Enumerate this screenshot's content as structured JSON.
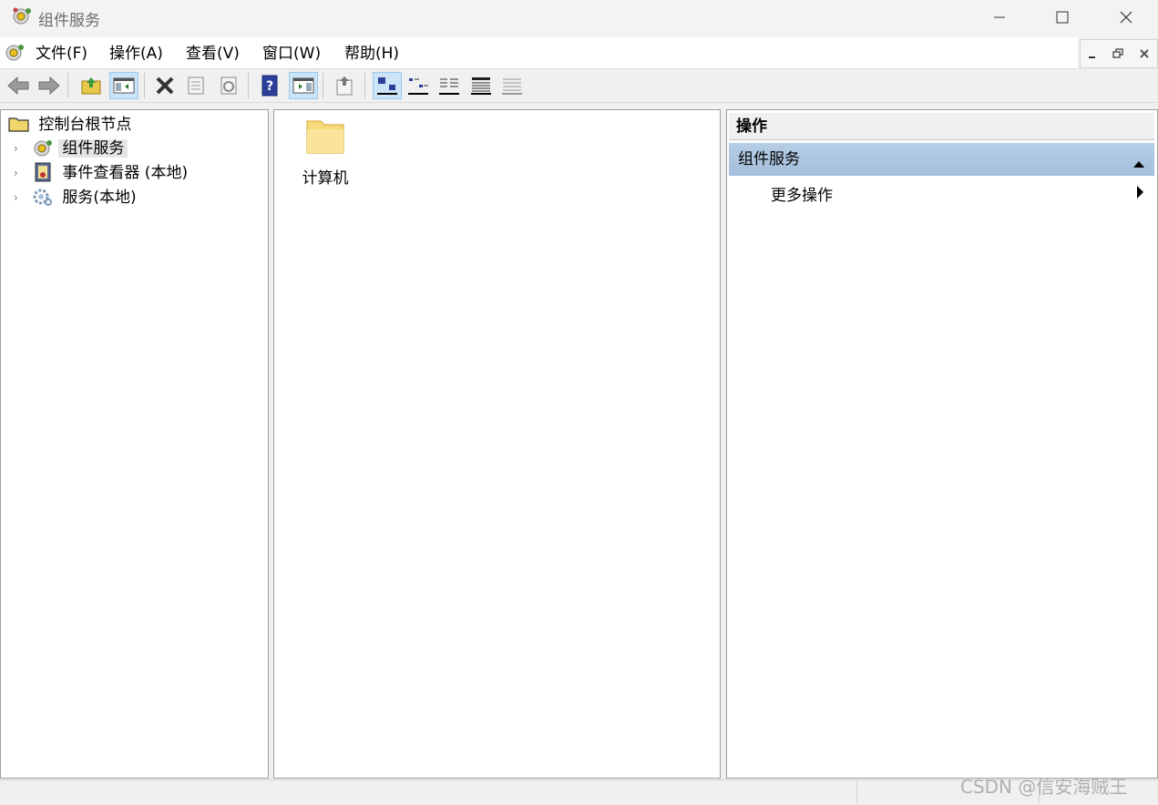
{
  "window": {
    "title": "组件服务",
    "icon": "component-services-icon",
    "controls": [
      "minimize-icon",
      "maximize-icon",
      "close-icon"
    ]
  },
  "menu": {
    "items": [
      {
        "label": "文件(F)"
      },
      {
        "label": "操作(A)"
      },
      {
        "label": "查看(V)"
      },
      {
        "label": "窗口(W)"
      },
      {
        "label": "帮助(H)"
      }
    ],
    "mdi_controls": [
      "mdi-minimize-icon",
      "mdi-restore-icon",
      "mdi-close-icon"
    ]
  },
  "toolbar": {
    "buttons": [
      {
        "icon": "back-arrow-icon"
      },
      {
        "icon": "forward-arrow-icon"
      },
      {
        "icon": "up-folder-icon"
      },
      {
        "icon": "show-hide-console-tree-icon",
        "active": true
      },
      {
        "icon": "delete-icon"
      },
      {
        "icon": "properties-icon"
      },
      {
        "icon": "refresh-icon"
      },
      {
        "icon": "help-icon"
      },
      {
        "icon": "show-hide-action-pane-icon",
        "active": true
      },
      {
        "icon": "export-list-icon"
      },
      {
        "icon": "large-icons-view-icon",
        "active": true
      },
      {
        "icon": "small-icons-view-icon"
      },
      {
        "icon": "list-view-icon"
      },
      {
        "icon": "detail-view-icon"
      },
      {
        "icon": "configure-view-icon"
      }
    ]
  },
  "tree": {
    "root": {
      "label": "控制台根节点",
      "icon": "folder-icon"
    },
    "children": [
      {
        "label": "组件服务",
        "icon": "component-services-icon",
        "selected": true
      },
      {
        "label": "事件查看器 (本地)",
        "icon": "event-viewer-icon"
      },
      {
        "label": "服务(本地)",
        "icon": "gear-icon"
      }
    ]
  },
  "content": {
    "items": [
      {
        "label": "计算机",
        "icon": "folder-icon"
      }
    ]
  },
  "actions": {
    "header": "操作",
    "group": "组件服务",
    "items": [
      {
        "label": "更多操作"
      }
    ]
  },
  "watermark": "CSDN @信安海贼王",
  "colors": {
    "selection_bg": "#e5e5e5",
    "action_group_bg": "#a9c3de",
    "toolbar_active": "#cce4f7"
  }
}
